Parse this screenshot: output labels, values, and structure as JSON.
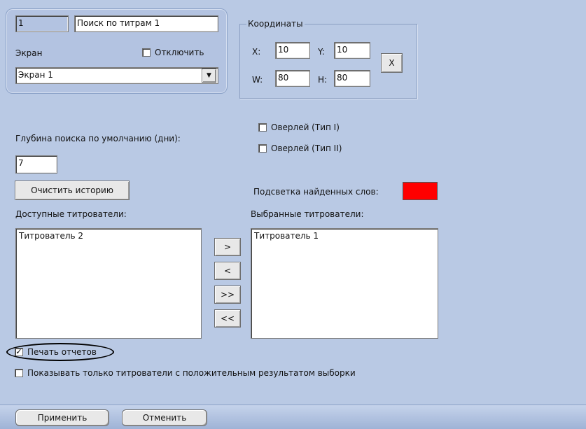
{
  "top_panel": {
    "id_value": "1",
    "name_value": "Поиск по титрам 1",
    "screen_label": "Экран",
    "disable_label": "Отключить",
    "screen_select_value": "Экран 1"
  },
  "coords": {
    "legend": "Координаты",
    "x_label": "X:",
    "x_value": "10",
    "y_label": "Y:",
    "y_value": "10",
    "w_label": "W:",
    "w_value": "80",
    "h_label": "H:",
    "h_value": "80",
    "reset_button": "X"
  },
  "overlays": {
    "type1_label": "Оверлей (Тип I)",
    "type2_label": "Оверлей (Тип II)"
  },
  "search_depth": {
    "label": "Глубина поиска по умолчанию (дни):",
    "value": "7"
  },
  "clear_history_button": "Очистить историю",
  "highlight": {
    "label": "Подсветка найденных слов:",
    "color": "#ff0000"
  },
  "available": {
    "label": "Доступные титрователи:",
    "items": [
      "Титрователь 2"
    ]
  },
  "selected": {
    "label": "Выбранные титрователи:",
    "items": [
      "Титрователь 1"
    ]
  },
  "transfer_buttons": {
    "add": ">",
    "remove": "<",
    "add_all": ">>",
    "remove_all": "<<"
  },
  "print_reports": {
    "label": "Печать отчетов",
    "checked": true
  },
  "show_positive_only": {
    "label": "Показывать только титрователи с положительным результатом выборки",
    "checked": false
  },
  "footer": {
    "apply_button": "Применить",
    "cancel_button": "Отменить"
  }
}
